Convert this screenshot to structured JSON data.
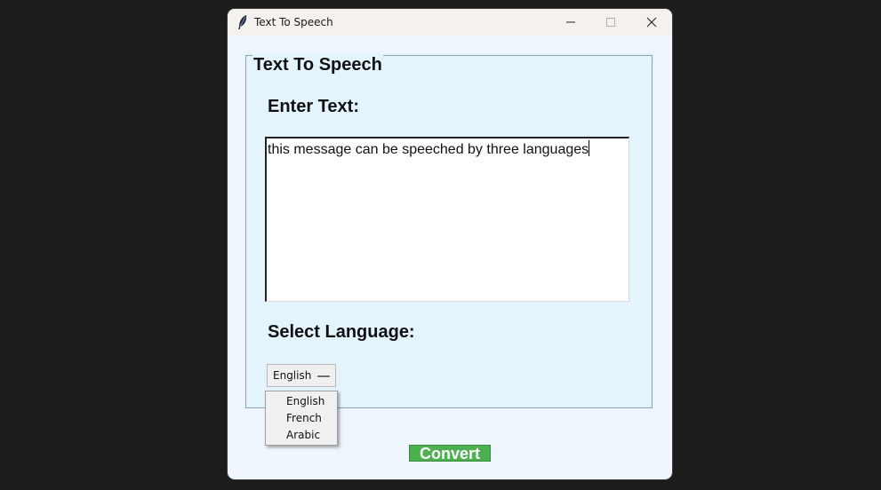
{
  "window": {
    "title": "Text To Speech"
  },
  "frame": {
    "legend": "Text To Speech"
  },
  "text_section": {
    "label": "Enter Text:",
    "value": "this message can be speeched by three languages"
  },
  "language_section": {
    "label": "Select Language:",
    "selected": "English",
    "options": [
      "English",
      "French",
      "Arabic"
    ]
  },
  "convert_button": {
    "label": "Convert"
  },
  "colors": {
    "window_bg": "#eef5fd",
    "frame_bg": "#e3f4fd",
    "convert_bg": "#4caf50",
    "desktop_bg": "#1c1c1c"
  },
  "icons": [
    "feather-icon",
    "minimize-icon",
    "maximize-icon",
    "close-icon",
    "dropdown-indicator-icon"
  ]
}
